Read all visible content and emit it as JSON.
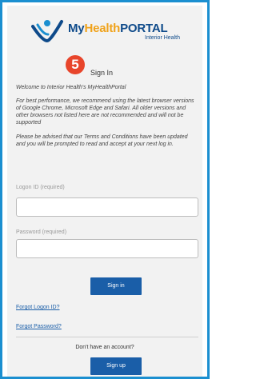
{
  "header": {
    "logo_my": "My",
    "logo_health": "Health",
    "logo_portal": "PORTAL",
    "logo_sub": "Interior Health",
    "step_number": "5",
    "title": "Sign In"
  },
  "info": {
    "welcome": "Welcome to Interior Health's MyHealthPortal",
    "browsers": "For best performance, we recommend using the latest browser versions of Google Chrome, Microsoft Edge and Safari. All older versions and other browsers not listed here are not recommended and will not be supported",
    "terms": "Please be advised that our Terms and Conditions have been updated and you will be prompted to read and accept at your next log in."
  },
  "form": {
    "logon_label": "Logon ID (required)",
    "logon_value": "",
    "password_label": "Password (required)",
    "password_value": "",
    "sign_in_label": "Sign in"
  },
  "links": {
    "forgot_logon": "Forgot Logon ID?",
    "forgot_password": "Forgot Password?"
  },
  "signup": {
    "prompt": "Don't have an account?",
    "button_label": "Sign up"
  },
  "colors": {
    "accent": "#1a5ea8",
    "frame": "#1b8fd0",
    "badge": "#e8452b",
    "brand_orange": "#f0a21a",
    "brand_navy": "#0e4a8a"
  }
}
